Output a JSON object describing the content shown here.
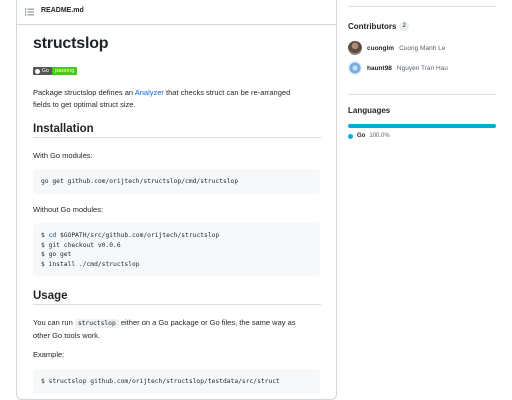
{
  "readme": {
    "filename": "README.md",
    "title": "structslop",
    "badge": {
      "left": "Go",
      "right": "passing",
      "left_color": "#555555",
      "right_color": "#44cc11"
    },
    "intro_before_link": "Package structslop defines an ",
    "intro_link": "Analyzer",
    "intro_after_link_line1": " that checks struct can be re-arranged",
    "intro_line2": "fields to get optimal struct size.",
    "installation": {
      "heading": "Installation",
      "with_modules": "With Go modules:",
      "with_modules_code": [
        "go get github.com/orijtech/structslop/cmd/structslop"
      ],
      "without_modules": "Without Go modules:",
      "without_modules_code": [
        {
          "prefix": "$ ",
          "cmd": "cd",
          "rest": " $GOPATH/src/github.com/orijtech/structslop"
        },
        {
          "prefix": "$ git checkout v0.0.6",
          "cmd": "",
          "rest": ""
        },
        {
          "prefix": "$ go get",
          "cmd": "",
          "rest": ""
        },
        {
          "prefix": "$ install ./cmd/structslop",
          "cmd": "",
          "rest": ""
        }
      ]
    },
    "usage": {
      "heading": "Usage",
      "line1_before": "You can run ",
      "line1_code": "structslop",
      "line1_after": " either on a Go package or Go files, the same way as",
      "line2": "other Go tools work.",
      "example_label": "Example:",
      "example_code": "$ structslop github.com/orijtech/structslop/testdata/src/struct"
    }
  },
  "sidebar": {
    "contributors": {
      "heading": "Contributors",
      "count": "2",
      "people": [
        {
          "login": "cuonglm",
          "name": "Cuong Manh Le"
        },
        {
          "login": "haunt98",
          "name": "Nguyen Tran Hau"
        }
      ]
    },
    "languages": {
      "heading": "Languages",
      "items": [
        {
          "name": "Go",
          "percent": "100.0%",
          "fraction": 1.0,
          "color": "#00add8"
        }
      ]
    }
  },
  "icons": {
    "list": "list-unordered-icon",
    "github": "github-mark-icon"
  }
}
